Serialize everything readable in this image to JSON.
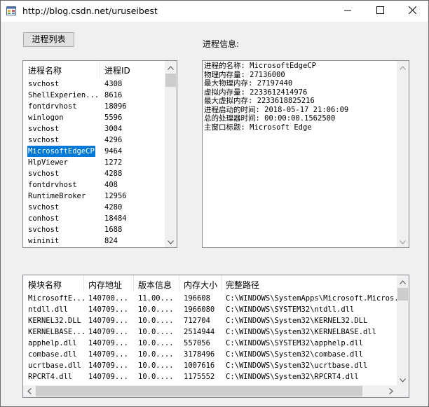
{
  "window": {
    "title": "http://blog.csdn.net/uruseibest",
    "minimize_icon": "minimize-icon",
    "maximize_icon": "maximize-icon",
    "close_icon": "close-icon"
  },
  "buttons": {
    "process_list": "进程列表"
  },
  "labels": {
    "process_info": "进程信息:"
  },
  "process_list": {
    "columns": [
      "进程名称",
      "进程ID"
    ],
    "rows": [
      [
        "svchost",
        "4308"
      ],
      [
        "ShellExperien...",
        "8616"
      ],
      [
        "fontdrvhost",
        "18096"
      ],
      [
        "winlogon",
        "5596"
      ],
      [
        "svchost",
        "3004"
      ],
      [
        "svchost",
        "4296"
      ],
      [
        "MicrosoftEdgeCP",
        "9464"
      ],
      [
        "HlpViewer",
        "1272"
      ],
      [
        "svchost",
        "4288"
      ],
      [
        "fontdrvhost",
        "408"
      ],
      [
        "RuntimeBroker",
        "12956"
      ],
      [
        "svchost",
        "4280"
      ],
      [
        "conhost",
        "18484"
      ],
      [
        "svchost",
        "1688"
      ],
      [
        "wininit",
        "824"
      ]
    ],
    "selected_index": 6
  },
  "process_info": {
    "lines": [
      "进程的名称: MicrosoftEdgeCP",
      "物理内存量: 27136000",
      "最大物理内存: 27197440",
      "虚拟内存量: 2233612414976",
      "最大虚拟内存: 2233618825216",
      "进程启动的时间: 2018-05-17 21:06:09",
      "总的处理器时间: 00:00:00.1562500",
      "主窗口标题: Microsoft Edge"
    ]
  },
  "module_list": {
    "columns": [
      "模块名称",
      "内存地址",
      "版本信息",
      "内存大小",
      "完整路径"
    ],
    "rows": [
      [
        "MicrosoftE...",
        "140700...",
        "11.00...",
        "196608",
        "C:\\WINDOWS\\SystemApps\\Microsoft.Micros..."
      ],
      [
        "ntdll.dll",
        "140709...",
        "10.0....",
        "1966080",
        "C:\\WINDOWS\\SYSTEM32\\ntdll.dll"
      ],
      [
        "KERNEL32.DLL",
        "140709...",
        "10.0....",
        "712704",
        "C:\\WINDOWS\\System32\\KERNEL32.DLL"
      ],
      [
        "KERNELBASE...",
        "140709...",
        "10.0....",
        "2514944",
        "C:\\WINDOWS\\System32\\KERNELBASE.dll"
      ],
      [
        "apphelp.dll",
        "140709...",
        "10.0....",
        "557056",
        "C:\\WINDOWS\\SYSTEM32\\apphelp.dll"
      ],
      [
        "combase.dll",
        "140709...",
        "10.0....",
        "3178496",
        "C:\\WINDOWS\\System32\\combase.dll"
      ],
      [
        "ucrtbase.dll",
        "140709...",
        "10.0....",
        "1007616",
        "C:\\WINDOWS\\System32\\ucrtbase.dll"
      ],
      [
        "RPCRT4.dll",
        "140709...",
        "10.0....",
        "1175552",
        "C:\\WINDOWS\\System32\\RPCRT4.dll"
      ]
    ]
  },
  "colors": {
    "selection": "#0078d7",
    "window_bg": "#f0f0f0",
    "list_bg": "#ffffff",
    "border": "#828790"
  }
}
